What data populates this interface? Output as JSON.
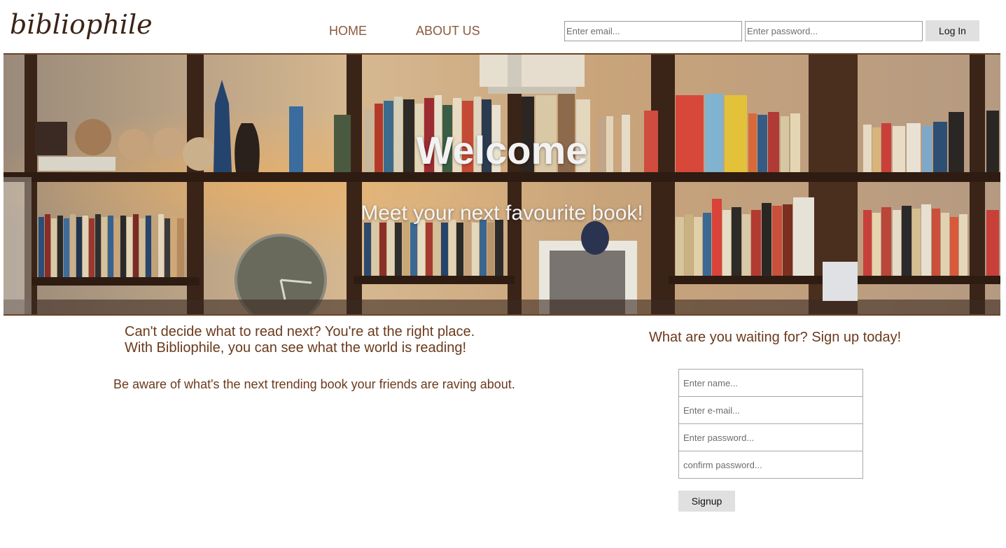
{
  "header": {
    "logo": "bibliophile",
    "nav": {
      "home": "HOME",
      "about": "ABOUT US"
    },
    "login": {
      "email_placeholder": "Enter email...",
      "password_placeholder": "Enter password...",
      "button": "Log In"
    }
  },
  "hero": {
    "title": "Welcome",
    "subtitle": "Meet your next favourite book!"
  },
  "main": {
    "intro_line1": "Can't decide what to read next? You're at the right place.",
    "intro_line2": "With Bibliophile, you can see what the world is reading!",
    "aware": "Be aware of what's the next trending book your friends are raving about."
  },
  "signup": {
    "cta": "What are you waiting for? Sign up today!",
    "name_placeholder": "Enter name...",
    "email_placeholder": "Enter e-mail...",
    "password_placeholder": "Enter password...",
    "confirm_placeholder": "confirm password...",
    "button": "Signup"
  },
  "colors": {
    "accent_brown": "#6b3a1c",
    "nav_brown": "#8a5a3c",
    "button_gray": "#e0e0e0"
  }
}
